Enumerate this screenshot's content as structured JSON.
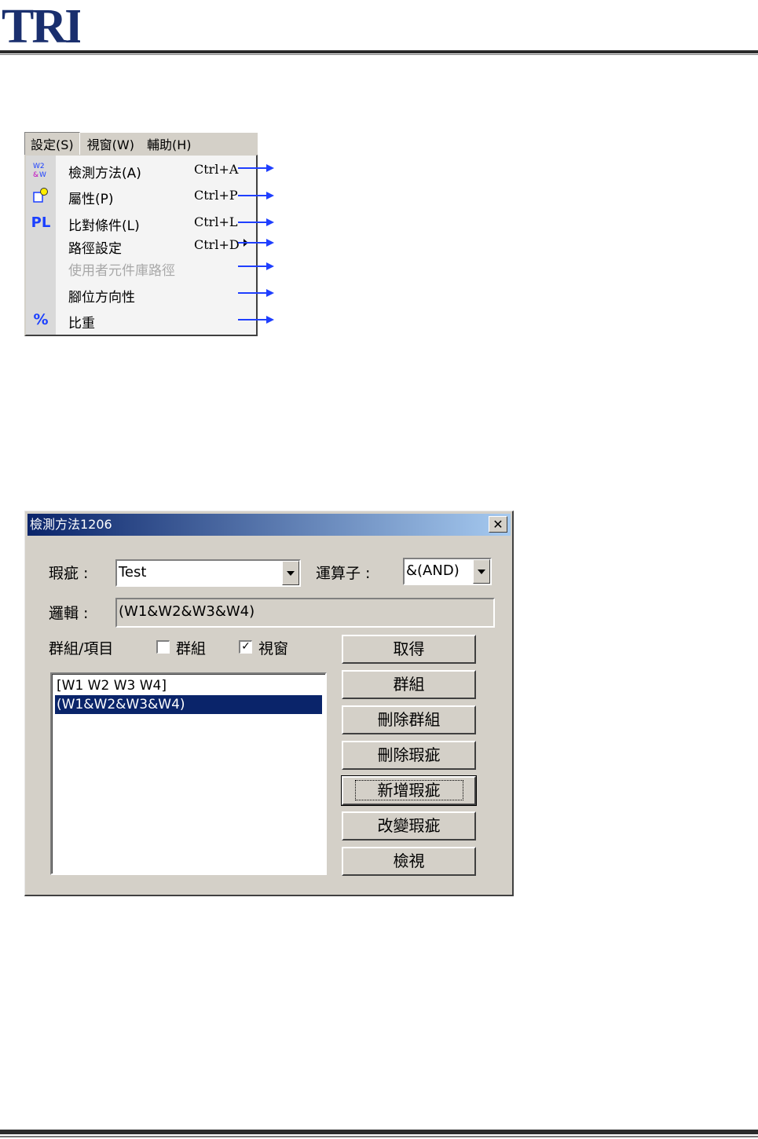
{
  "logo": {
    "text": "TRI"
  },
  "menubar": {
    "items": [
      {
        "label": "設定(S)",
        "active": true
      },
      {
        "label": "視窗(W)"
      },
      {
        "label": "輔助(H)"
      }
    ]
  },
  "dropdown": {
    "items": [
      {
        "label": "檢測方法(A)",
        "shortcut": "Ctrl+A",
        "icon": "w2-vm-icon"
      },
      {
        "label": "屬性(P)",
        "shortcut": "Ctrl+P",
        "icon": "property-icon"
      },
      {
        "label": "比對條件(L)",
        "shortcut": "Ctrl+L",
        "icon": "pl-icon",
        "icon_text": "PL"
      },
      {
        "label": "路徑設定",
        "shortcut": "Ctrl+D",
        "submenu": true
      },
      {
        "label": "使用者元件庫路徑",
        "shortcut": "",
        "disabled": true
      },
      {
        "label": "腳位方向性",
        "shortcut": ""
      },
      {
        "label": "比重",
        "shortcut": "",
        "icon": "percent-icon",
        "icon_text": "%"
      }
    ],
    "arrow_color": "#1f3fff"
  },
  "dialog": {
    "title": "檢測方法1206",
    "defect_label": "瑕疵 :",
    "defect_value": "Test",
    "operator_label": "運算子 :",
    "operator_value": "&(AND)",
    "logic_label": "邏輯 :",
    "logic_value": "(W1&W2&W3&W4)",
    "group_item_label": "群組/項目",
    "group_checkbox": {
      "label": "群組",
      "checked": false
    },
    "window_checkbox": {
      "label": "視窗",
      "checked": true,
      "mark": "✓"
    },
    "list_items": [
      {
        "text": "[W1 W2 W3 W4]",
        "selected": false
      },
      {
        "text": "(W1&W2&W3&W4)",
        "selected": true
      }
    ],
    "buttons": {
      "get": "取得",
      "group": "群組",
      "delete_group": "刪除群組",
      "delete_defect": "刪除瑕疵",
      "add_defect": "新增瑕疵",
      "change_defect": "改變瑕疵",
      "view": "檢視"
    },
    "close_glyph": "✕"
  }
}
